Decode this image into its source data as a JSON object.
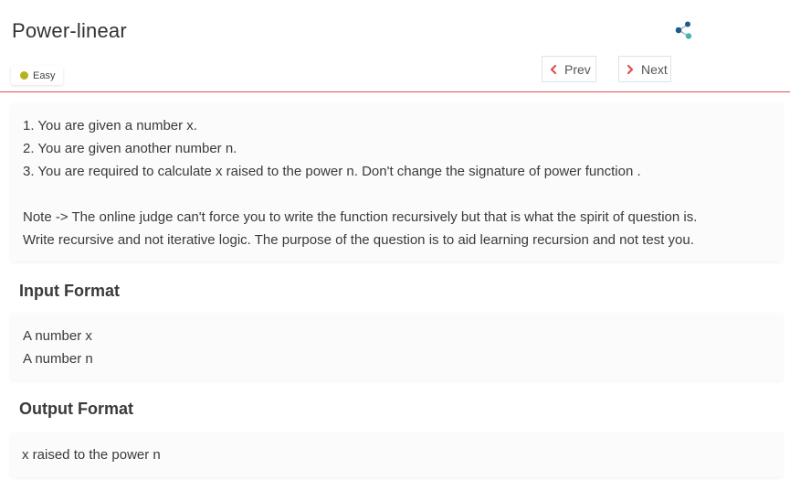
{
  "problem": {
    "title": "Power-linear",
    "difficulty": "Easy",
    "difficulty_color": "#b5b21a"
  },
  "nav": {
    "prev_label": "Prev",
    "next_label": "Next",
    "chevron_color": "#e04e4e"
  },
  "icons": {
    "share": "share-icon",
    "prev": "chevron-left-icon",
    "next": "chevron-right-icon"
  },
  "description": {
    "lines": [
      "1. You are given a number x.",
      "2. You are given another number n.",
      "3. You are required to calculate x raised to the power n. Don't change the signature of power function ."
    ],
    "note_lines": [
      "Note -> The online judge can't force you to write the function recursively but that is what the spirit of question is.",
      "Write recursive and not iterative logic. The purpose of the question is to aid learning recursion and not test you."
    ]
  },
  "input_format": {
    "heading": "Input Format",
    "lines": [
      "A number x",
      "A number n"
    ]
  },
  "output_format": {
    "heading": "Output Format",
    "lines": [
      "x raised to the power n"
    ]
  },
  "colors": {
    "header_border": "#e04e4e",
    "share_dark": "#1f5c8a",
    "share_light": "#45b7a8"
  }
}
